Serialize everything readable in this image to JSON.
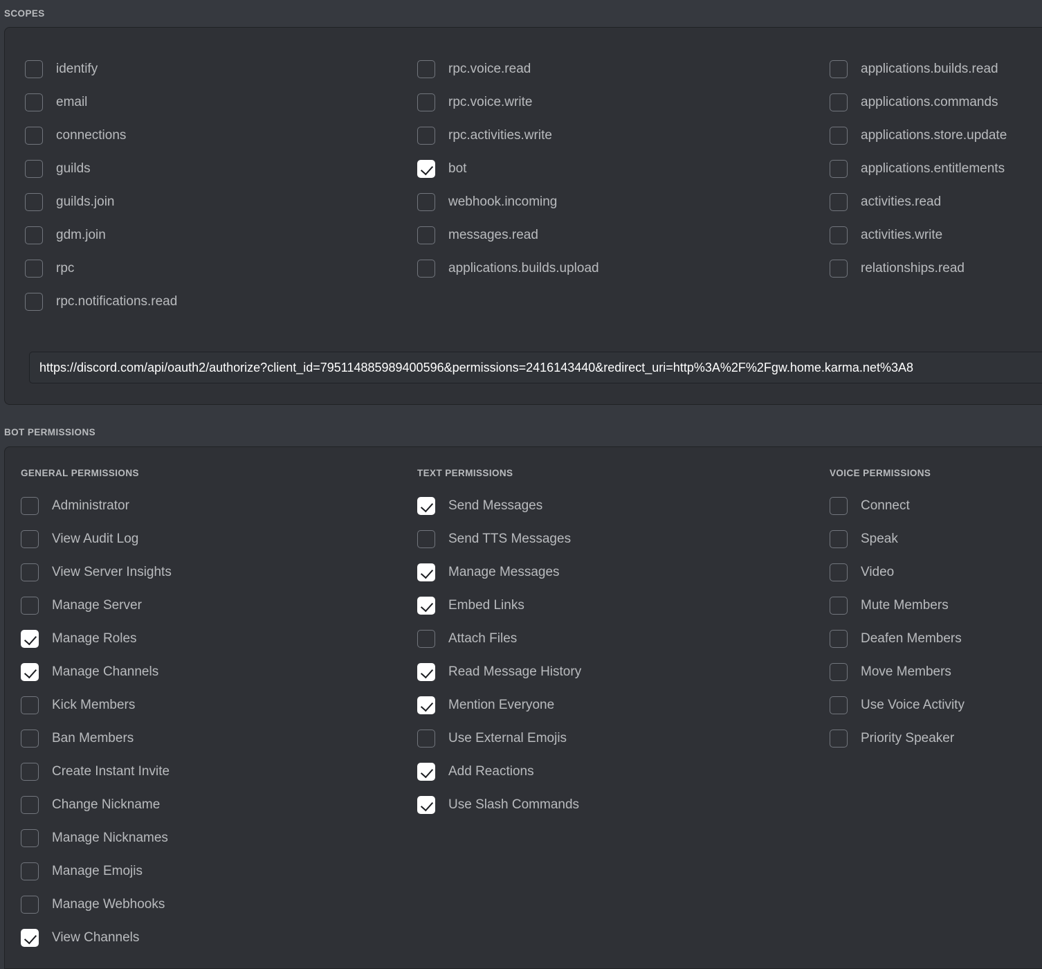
{
  "scopes_section": {
    "label": "SCOPES",
    "columns": [
      {
        "name": "scopes-column-1",
        "items": [
          {
            "label": "identify",
            "checked": false
          },
          {
            "label": "email",
            "checked": false
          },
          {
            "label": "connections",
            "checked": false
          },
          {
            "label": "guilds",
            "checked": false
          },
          {
            "label": "guilds.join",
            "checked": false
          },
          {
            "label": "gdm.join",
            "checked": false
          },
          {
            "label": "rpc",
            "checked": false
          },
          {
            "label": "rpc.notifications.read",
            "checked": false
          }
        ]
      },
      {
        "name": "scopes-column-2",
        "items": [
          {
            "label": "rpc.voice.read",
            "checked": false
          },
          {
            "label": "rpc.voice.write",
            "checked": false
          },
          {
            "label": "rpc.activities.write",
            "checked": false
          },
          {
            "label": "bot",
            "checked": true
          },
          {
            "label": "webhook.incoming",
            "checked": false
          },
          {
            "label": "messages.read",
            "checked": false
          },
          {
            "label": "applications.builds.upload",
            "checked": false
          }
        ]
      },
      {
        "name": "scopes-column-3",
        "items": [
          {
            "label": "applications.builds.read",
            "checked": false
          },
          {
            "label": "applications.commands",
            "checked": false
          },
          {
            "label": "applications.store.update",
            "checked": false
          },
          {
            "label": "applications.entitlements",
            "checked": false
          },
          {
            "label": "activities.read",
            "checked": false
          },
          {
            "label": "activities.write",
            "checked": false
          },
          {
            "label": "relationships.read",
            "checked": false
          }
        ]
      }
    ],
    "generated_url": {
      "value": "https://discord.com/api/oauth2/authorize?client_id=795114885989400596&permissions=2416143440&redirect_uri=http%3A%2F%2Fgw.home.karma.net%3A8",
      "placeholder": ""
    }
  },
  "bot_permissions_section": {
    "label": "BOT PERMISSIONS",
    "columns": [
      {
        "title": "GENERAL PERMISSIONS",
        "name": "general-permissions-column",
        "items": [
          {
            "label": "Administrator",
            "checked": false
          },
          {
            "label": "View Audit Log",
            "checked": false
          },
          {
            "label": "View Server Insights",
            "checked": false
          },
          {
            "label": "Manage Server",
            "checked": false
          },
          {
            "label": "Manage Roles",
            "checked": true
          },
          {
            "label": "Manage Channels",
            "checked": true
          },
          {
            "label": "Kick Members",
            "checked": false
          },
          {
            "label": "Ban Members",
            "checked": false
          },
          {
            "label": "Create Instant Invite",
            "checked": false
          },
          {
            "label": "Change Nickname",
            "checked": false
          },
          {
            "label": "Manage Nicknames",
            "checked": false
          },
          {
            "label": "Manage Emojis",
            "checked": false
          },
          {
            "label": "Manage Webhooks",
            "checked": false
          },
          {
            "label": "View Channels",
            "checked": true
          }
        ]
      },
      {
        "title": "TEXT PERMISSIONS",
        "name": "text-permissions-column",
        "items": [
          {
            "label": "Send Messages",
            "checked": true
          },
          {
            "label": "Send TTS Messages",
            "checked": false
          },
          {
            "label": "Manage Messages",
            "checked": true
          },
          {
            "label": "Embed Links",
            "checked": true
          },
          {
            "label": "Attach Files",
            "checked": false
          },
          {
            "label": "Read Message History",
            "checked": true
          },
          {
            "label": "Mention Everyone",
            "checked": true
          },
          {
            "label": "Use External Emojis",
            "checked": false
          },
          {
            "label": "Add Reactions",
            "checked": true
          },
          {
            "label": "Use Slash Commands",
            "checked": true
          }
        ]
      },
      {
        "title": "VOICE PERMISSIONS",
        "name": "voice-permissions-column",
        "items": [
          {
            "label": "Connect",
            "checked": false
          },
          {
            "label": "Speak",
            "checked": false
          },
          {
            "label": "Video",
            "checked": false
          },
          {
            "label": "Mute Members",
            "checked": false
          },
          {
            "label": "Deafen Members",
            "checked": false
          },
          {
            "label": "Move Members",
            "checked": false
          },
          {
            "label": "Use Voice Activity",
            "checked": false
          },
          {
            "label": "Priority Speaker",
            "checked": false
          }
        ]
      }
    ]
  },
  "colors": {
    "page_background": "#36393f",
    "panel_background": "#2f3136",
    "panel_border": "#202225",
    "text_primary": "#b9bbbe",
    "checkbox_border": "#72767d",
    "checkbox_checked_fill": "#ffffff",
    "checkmark": "#1a1c20",
    "input_background": "#303338",
    "input_text": "#ffffff"
  }
}
